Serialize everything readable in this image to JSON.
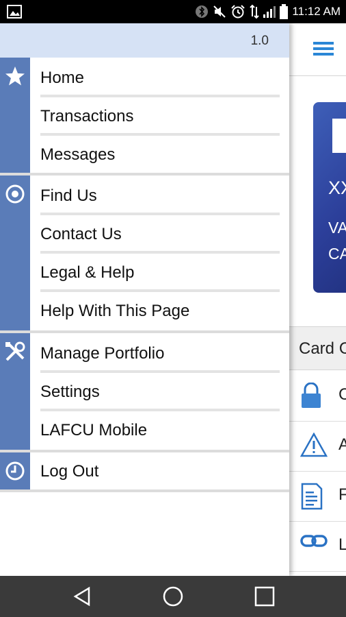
{
  "status_bar": {
    "time": "11:12 AM",
    "icons": [
      "gallery-icon",
      "bluetooth-icon",
      "mute-icon",
      "alarm-icon",
      "data-icon",
      "signal-icon",
      "battery-icon"
    ]
  },
  "drawer": {
    "version": "1.0",
    "accent_color": "#5a7cb8",
    "groups": [
      {
        "icon": "star-icon",
        "items": [
          {
            "label": "Home"
          },
          {
            "label": "Transactions"
          },
          {
            "label": "Messages"
          }
        ]
      },
      {
        "icon": "target-icon",
        "items": [
          {
            "label": "Find Us"
          },
          {
            "label": "Contact Us"
          },
          {
            "label": "Legal & Help"
          },
          {
            "label": "Help With This Page"
          }
        ]
      },
      {
        "icon": "tools-icon",
        "items": [
          {
            "label": "Manage Portfolio"
          },
          {
            "label": "Settings"
          },
          {
            "label": "LAFCU Mobile"
          }
        ]
      },
      {
        "icon": "clock-icon",
        "items": [
          {
            "label": "Log Out"
          }
        ]
      }
    ]
  },
  "background": {
    "menu_icon": "hamburger-icon",
    "card": {
      "line1": "XX",
      "line2": "VA",
      "line3": "CA"
    },
    "section_title": "Card C",
    "rows": [
      {
        "icon": "lock-icon",
        "label": "C"
      },
      {
        "icon": "alert-icon",
        "label": "A"
      },
      {
        "icon": "document-icon",
        "label": "F"
      },
      {
        "icon": "link-icon",
        "label": "L"
      }
    ]
  },
  "navbar": {
    "buttons": [
      "back-icon",
      "home-icon",
      "recents-icon"
    ]
  }
}
